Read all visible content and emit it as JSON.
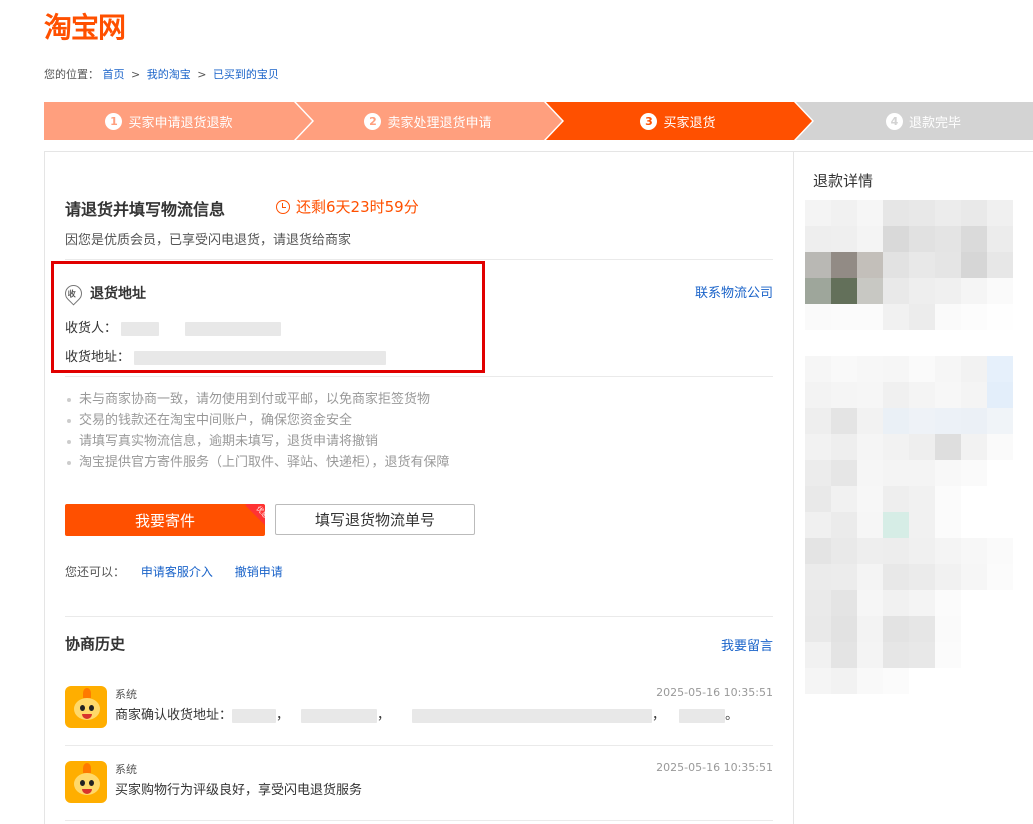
{
  "brand": {
    "logo_text": "淘宝网"
  },
  "breadcrumb": {
    "prefix": "您的位置：",
    "items": [
      "首页",
      "我的淘宝",
      "已买到的宝贝"
    ],
    "separator": ">"
  },
  "steps": [
    {
      "num": "1",
      "label": "买家申请退货退款",
      "state": "done"
    },
    {
      "num": "2",
      "label": "卖家处理退货申请",
      "state": "done"
    },
    {
      "num": "3",
      "label": "买家退货",
      "state": "current"
    },
    {
      "num": "4",
      "label": "退款完毕",
      "state": "todo"
    }
  ],
  "main": {
    "title": "请退货并填写物流信息",
    "countdown": "还剩6天23时59分",
    "subtitle": "因您是优质会员，已享受闪电退货，请退货给商家",
    "address": {
      "title": "退货地址",
      "icon_text": "收",
      "receiver_label": "收货人：",
      "address_label": "收货地址：",
      "contact_link": "联系物流公司"
    },
    "tips": [
      "未与商家协商一致，请勿使用到付或平邮，以免商家拒签货物",
      "交易的钱款还在淘宝中间账户，确保您资金安全",
      "请填写真实物流信息，逾期未填写，退货申请将撤销",
      "淘宝提供官方寄件服务（上门取件、驿站、快递柜），退货有保障"
    ],
    "buttons": {
      "send": "我要寄件",
      "send_badge": "优惠",
      "fill": "填写退货物流单号"
    },
    "also": {
      "label": "您还可以：",
      "links": [
        "申请客服介入",
        "撤销申请"
      ]
    }
  },
  "history": {
    "title": "协商历史",
    "leave_msg": "我要留言",
    "items": [
      {
        "name": "系统",
        "time": "2025-05-16 10:35:51",
        "text_prefix": "商家确认收货地址：",
        "text_suffix": "。"
      },
      {
        "name": "系统",
        "time": "2025-05-16 10:35:51",
        "text": "买家购物行为评级良好，享受闪电退货服务"
      }
    ]
  },
  "side": {
    "title": "退款详情"
  },
  "colors": {
    "brand_orange": "#ff5000",
    "step_done": "#ff9f7e",
    "step_todo": "#d3d3d3",
    "link_blue": "#1a63c9",
    "highlight_red": "#e10000"
  }
}
